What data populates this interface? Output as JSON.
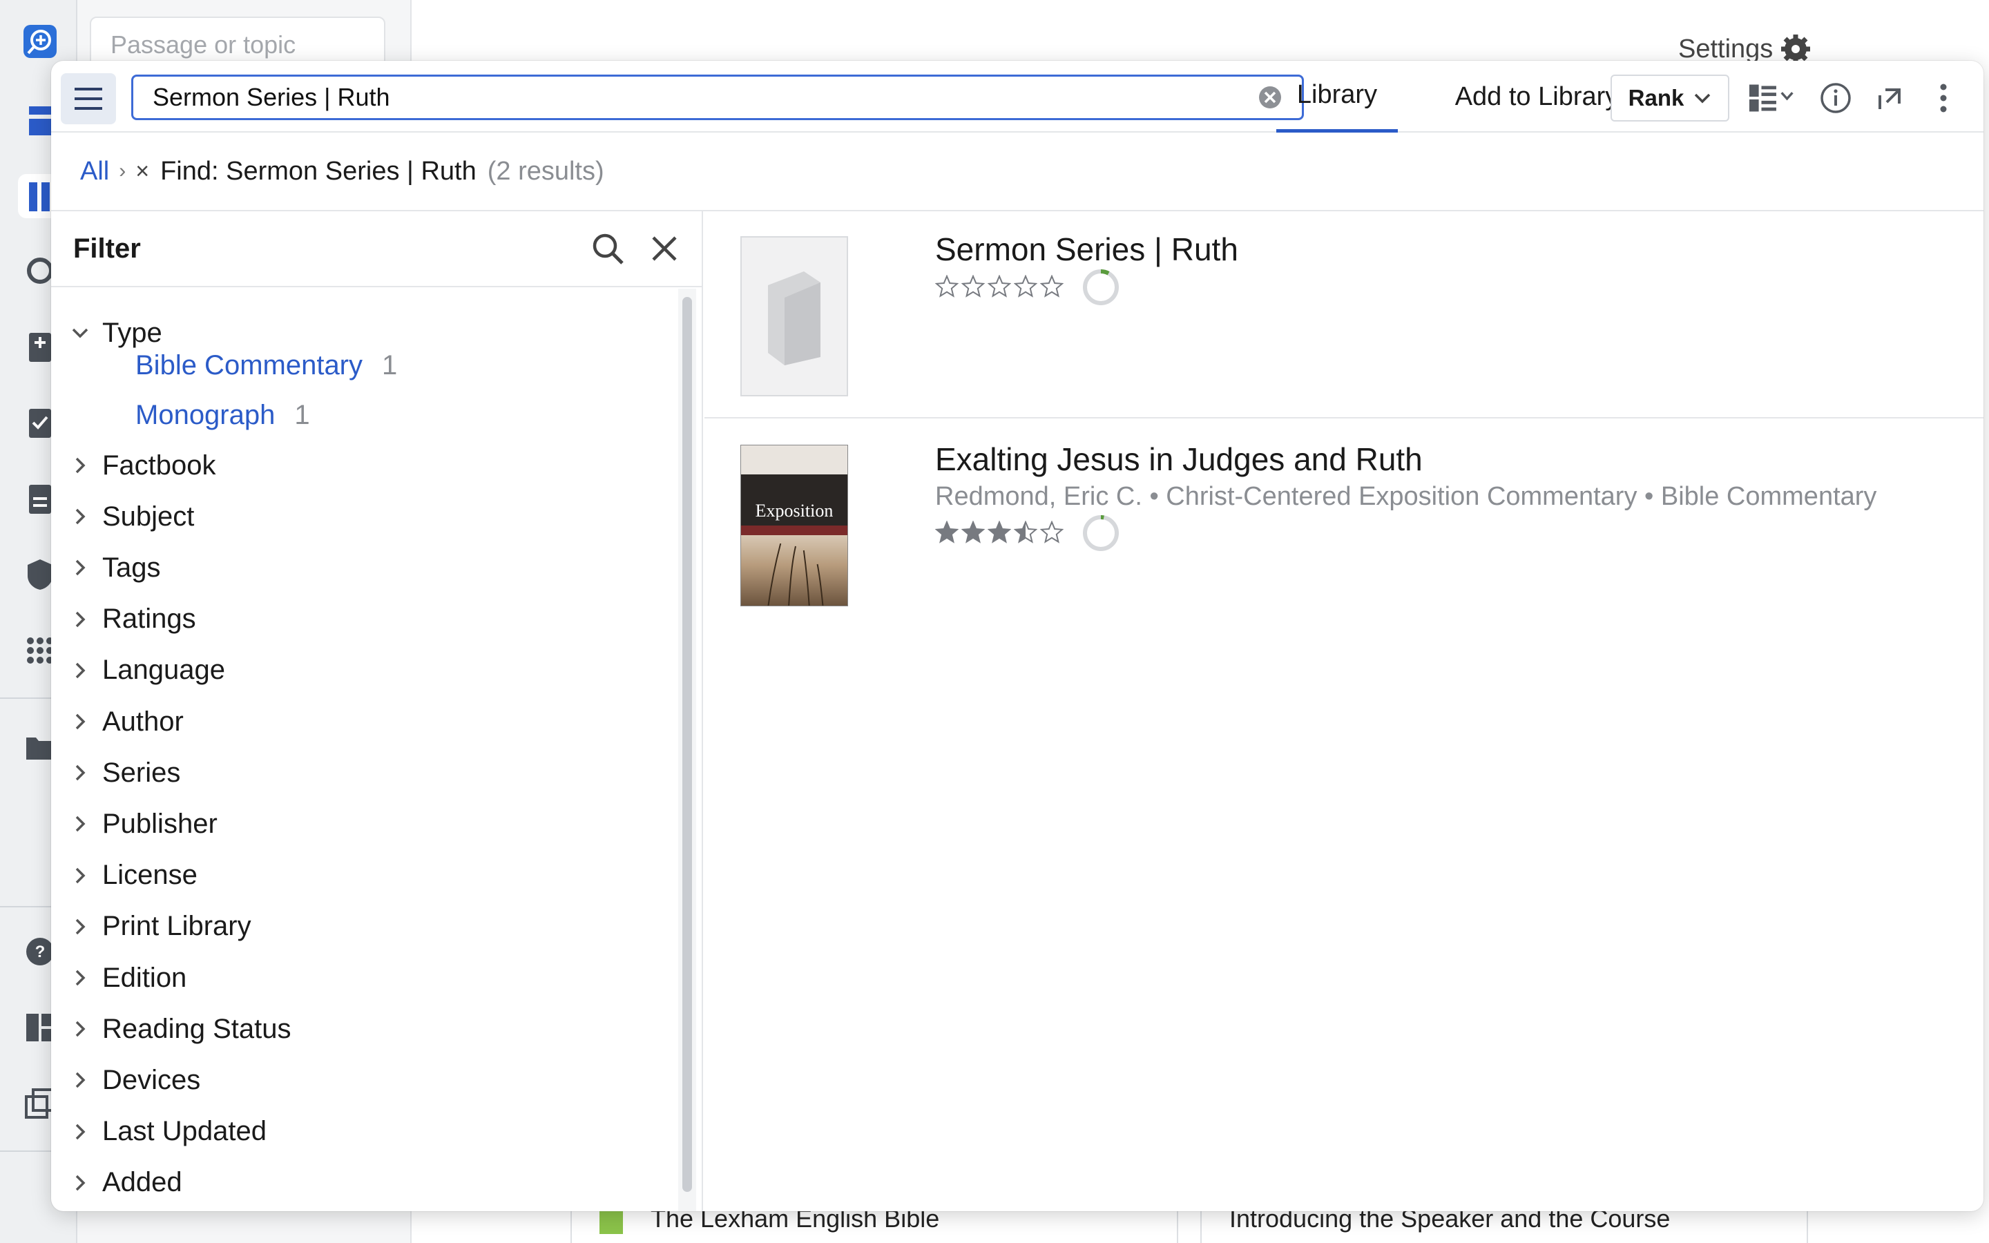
{
  "background": {
    "search_placeholder": "Passage or topic",
    "settings_label": "Settings",
    "cards": [
      {
        "text": "The Lexham English Bible"
      },
      {
        "text": "Introducing the Speaker and the Course"
      }
    ]
  },
  "toolbar": {
    "search_value": "Sermon Series | Ruth",
    "tabs": [
      {
        "label": "Library",
        "active": true
      },
      {
        "label": "Add to Library",
        "active": false
      }
    ],
    "rank_label": "Rank"
  },
  "breadcrumb": {
    "all_label": "All",
    "separator": "›",
    "remove_label": "×",
    "find_label": "Find: Sermon Series | Ruth",
    "result_count": "(2 results)"
  },
  "filter": {
    "title": "Filter",
    "type_label": "Type",
    "type_options": [
      {
        "label": "Bible Commentary",
        "count": "1"
      },
      {
        "label": "Monograph",
        "count": "1"
      }
    ],
    "categories": [
      "Factbook",
      "Subject",
      "Tags",
      "Ratings",
      "Language",
      "Author",
      "Series",
      "Publisher",
      "License",
      "Print Library",
      "Edition",
      "Reading Status",
      "Devices",
      "Last Updated",
      "Added"
    ]
  },
  "results": [
    {
      "title": "Sermon Series | Ruth",
      "meta": "",
      "rating": 0,
      "progress": 0.08
    },
    {
      "title": "Exalting Jesus in Judges and Ruth",
      "meta": "Redmond, Eric C. • Christ-Centered Exposition Commentary • Bible Commentary",
      "cover_title": "Exposition",
      "rating": 3.5,
      "progress": 0.03
    }
  ],
  "colors": {
    "accent": "#2b5bc8",
    "progress_green": "#5a9b3d",
    "muted": "#8a8d92"
  }
}
